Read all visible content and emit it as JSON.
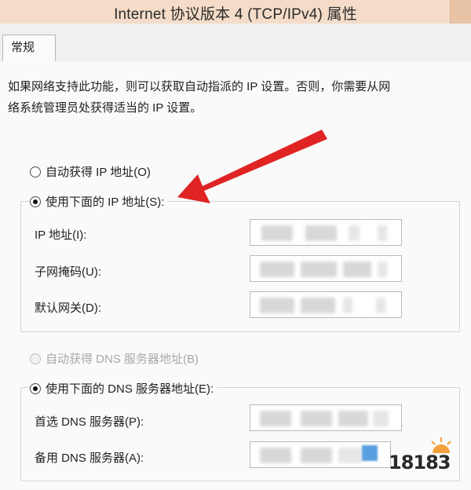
{
  "window": {
    "title": "Internet 协议版本 4 (TCP/IPv4) 属性"
  },
  "tabs": [
    {
      "label": "常规",
      "active": true
    }
  ],
  "intro_text_line1": "如果网络支持此功能，则可以获取自动指派的 IP 设置。否则，你需要从网",
  "intro_text_line2": "络系统管理员处获得适当的 IP 设置。",
  "ip": {
    "auto_label": "自动获得 IP 地址(O)",
    "manual_label": "使用下面的 IP 地址(S):",
    "selected": "manual",
    "fields": [
      {
        "label": "IP 地址(I):",
        "value": ""
      },
      {
        "label": "子网掩码(U):",
        "value": ""
      },
      {
        "label": "默认网关(D):",
        "value": ""
      }
    ]
  },
  "dns": {
    "auto_label": "自动获得 DNS 服务器地址(B)",
    "manual_label": "使用下面的 DNS 服务器地址(E):",
    "selected": "manual",
    "auto_disabled": true,
    "fields": [
      {
        "label": "首选 DNS 服务器(P):",
        "value": ""
      },
      {
        "label": "备用 DNS 服务器(A):",
        "value": ""
      }
    ]
  },
  "watermark": {
    "text": "18183",
    "color": "#e25b1b"
  },
  "colors": {
    "titlebar": "#f4dcc8",
    "arrow": "#e02424",
    "panel": "#fafafa"
  }
}
